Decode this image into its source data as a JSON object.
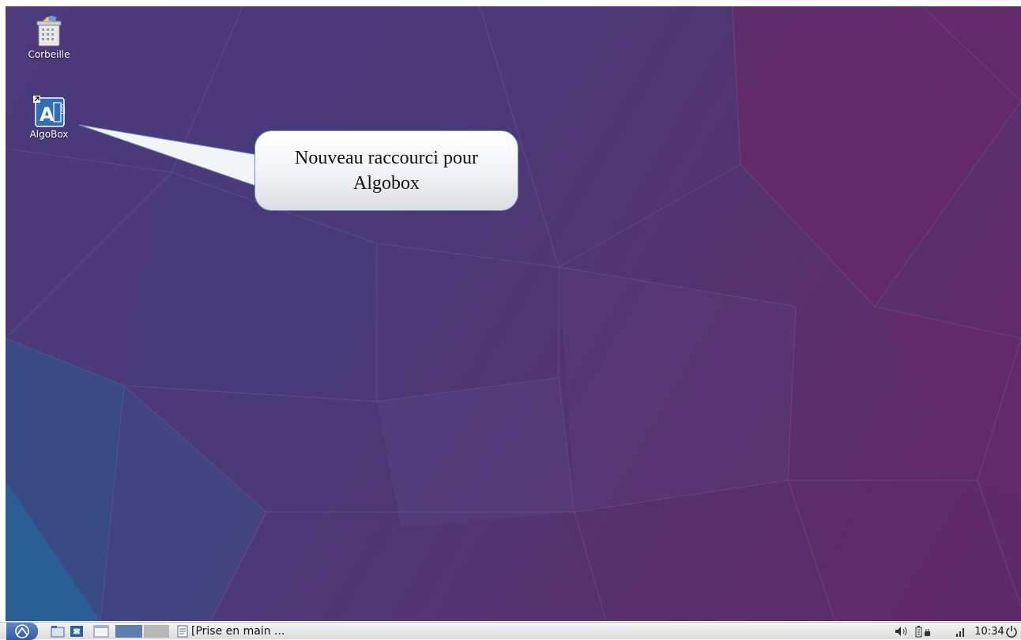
{
  "desktop": {
    "icons": [
      {
        "label": "Corbeille",
        "icon": "trash-icon"
      },
      {
        "label": "AlgoBox",
        "icon": "algobox-icon"
      }
    ]
  },
  "callout": {
    "line1": "Nouveau raccourci pour",
    "line2": "Algobox"
  },
  "taskbar": {
    "task_label": "[Prise en main ...",
    "clock": "10:34"
  },
  "colors": {
    "wallpaper_blue": "#4b3a7c",
    "wallpaper_magenta": "#5f2c69",
    "taskbar_bg": "#e6e6e6",
    "start_blue": "#3565b0"
  }
}
